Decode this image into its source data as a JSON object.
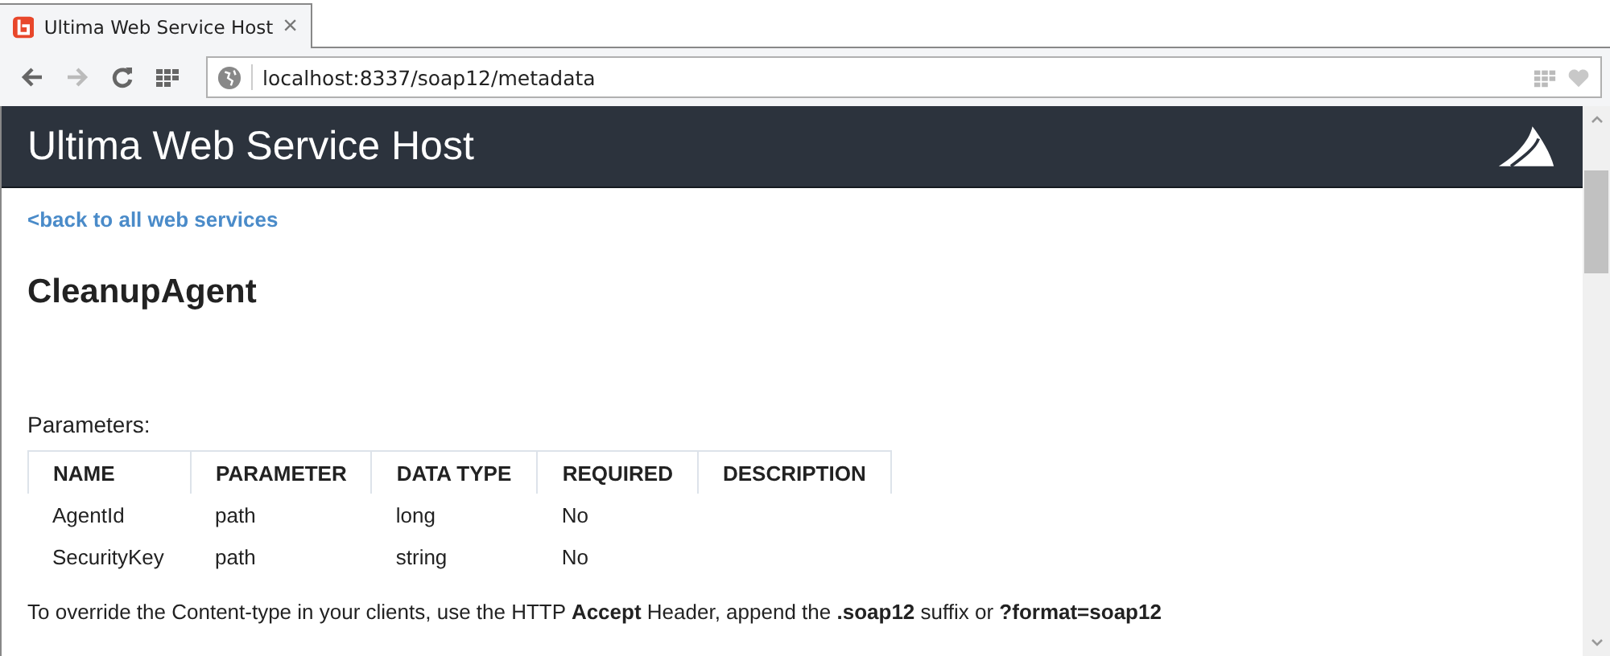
{
  "browser": {
    "tab": {
      "title": "Ultima Web Service Host",
      "close": "×"
    },
    "address": "localhost:8337/soap12/metadata"
  },
  "header": {
    "title": "Ultima Web Service Host"
  },
  "back_link": "<back to all web services",
  "heading": "CleanupAgent",
  "parameters_label": "Parameters:",
  "table": {
    "columns": [
      "NAME",
      "PARAMETER",
      "DATA TYPE",
      "REQUIRED",
      "DESCRIPTION"
    ],
    "rows": [
      [
        "AgentId",
        "path",
        "long",
        "No"
      ],
      [
        "SecurityKey",
        "path",
        "string",
        "No"
      ]
    ]
  },
  "note": "To override the Content-type in your clients, use the HTTP **Accept** Header, append the **.soap12** suffix or **?format=soap12**"
}
